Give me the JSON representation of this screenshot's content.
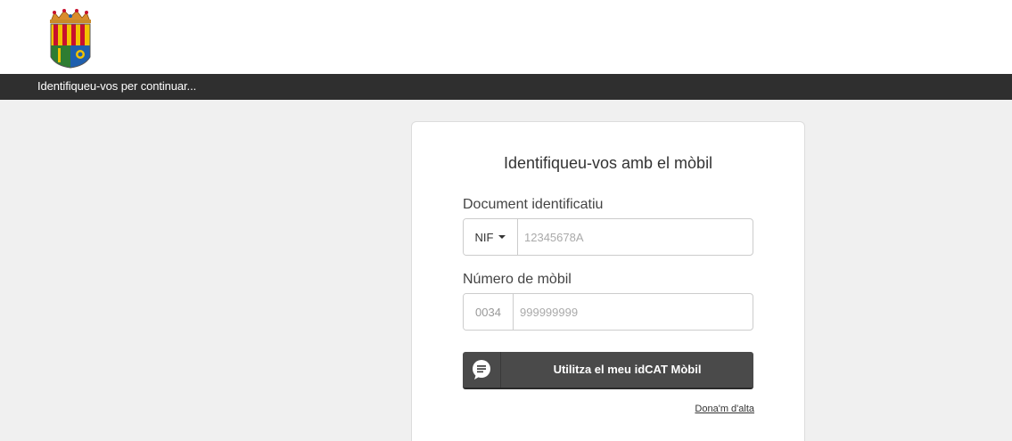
{
  "header": {
    "logo_icon": "municipal-coat-of-arms"
  },
  "titlebar": {
    "text": "Identifiqueu-vos per continuar..."
  },
  "card": {
    "title": "Identifiqueu-vos amb el mòbil",
    "document": {
      "label": "Document identificatiu",
      "type_selected": "NIF",
      "placeholder": "12345678A"
    },
    "mobile": {
      "label": "Número de mòbil",
      "prefix": "0034",
      "placeholder": "999999999"
    },
    "submit": {
      "label": "Utilitza el meu idCAT Mòbil",
      "icon": "speech-bubble-icon"
    },
    "signup_link": "Dona'm d'alta"
  },
  "colors": {
    "titlebar_bg": "#2f2f2f",
    "page_bg": "#f0f0f0",
    "button_bg": "#4a4a4a",
    "shield_red": "#c8102e",
    "shield_gold": "#f2c200",
    "shield_green": "#2e7d32",
    "shield_blue": "#1f5fae"
  }
}
